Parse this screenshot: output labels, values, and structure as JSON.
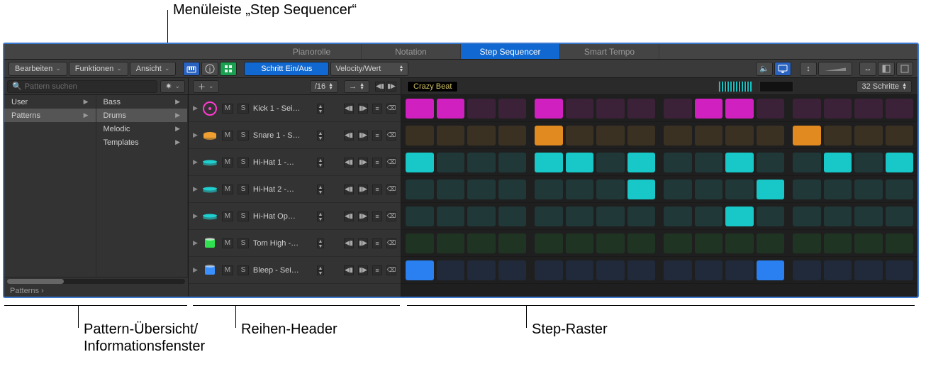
{
  "annotations": {
    "menubar": "Menüleiste „Step Sequencer“",
    "pattern_overview_1": "Pattern-Übersicht/",
    "pattern_overview_2": "Informationsfenster",
    "row_header": "Reihen-Header",
    "step_grid": "Step-Raster"
  },
  "tabs": [
    {
      "label": "Pianorolle",
      "active": false
    },
    {
      "label": "Notation",
      "active": false
    },
    {
      "label": "Step Sequencer",
      "active": true
    },
    {
      "label": "Smart Tempo",
      "active": false
    }
  ],
  "toolbar": {
    "edit": "Bearbeiten",
    "functions": "Funktionen",
    "view": "Ansicht",
    "step_toggle": "Schritt Ein/Aus",
    "mode": "Velocity/Wert"
  },
  "search": {
    "placeholder": "Pattern suchen"
  },
  "pattern": {
    "name": "Crazy Beat",
    "steps_label": "32 Schritte",
    "division": "/16"
  },
  "sidebar": {
    "col1": [
      {
        "label": "User",
        "sel": false
      },
      {
        "label": "Patterns",
        "sel": true
      }
    ],
    "col2": [
      {
        "label": "Bass",
        "sel": false
      },
      {
        "label": "Drums",
        "sel": true
      },
      {
        "label": "Melodic",
        "sel": false
      },
      {
        "label": "Templates",
        "sel": false
      }
    ],
    "breadcrumb": "Patterns  ›"
  },
  "rows": [
    {
      "name": "Kick 1 - Sei…",
      "icon": "kick",
      "color": "#ff3ad0",
      "on": "kick-on",
      "off": "kick-off",
      "steps": [
        1,
        1,
        0,
        0,
        1,
        0,
        0,
        0,
        0,
        1,
        1,
        0,
        0,
        0,
        0,
        0
      ]
    },
    {
      "name": "Snare 1 - S…",
      "icon": "snare",
      "color": "#f0a030",
      "on": "snare-on",
      "off": "snare-off",
      "steps": [
        0,
        0,
        0,
        0,
        1,
        0,
        0,
        0,
        0,
        0,
        0,
        0,
        1,
        0,
        0,
        0
      ]
    },
    {
      "name": "Hi-Hat 1 -…",
      "icon": "hihat",
      "color": "#20d0d0",
      "on": "hh-on",
      "off": "hh-off",
      "steps": [
        1,
        0,
        0,
        0,
        1,
        1,
        0,
        1,
        0,
        0,
        1,
        0,
        0,
        1,
        0,
        1
      ]
    },
    {
      "name": "Hi-Hat 2 -…",
      "icon": "hihat",
      "color": "#20d0d0",
      "on": "hh-on",
      "off": "hh-off",
      "steps": [
        0,
        0,
        0,
        0,
        0,
        0,
        0,
        1,
        0,
        0,
        0,
        1,
        0,
        0,
        0,
        0
      ]
    },
    {
      "name": "Hi-Hat Op…",
      "icon": "hihat",
      "color": "#20d0d0",
      "on": "hh-on",
      "off": "hh-off",
      "steps": [
        0,
        0,
        0,
        0,
        0,
        0,
        0,
        0,
        0,
        0,
        1,
        0,
        0,
        0,
        0,
        0
      ]
    },
    {
      "name": "Tom High -…",
      "icon": "tom",
      "color": "#30e050",
      "on": "tom-on",
      "off": "tom-off",
      "steps": [
        0,
        0,
        0,
        0,
        0,
        0,
        0,
        0,
        0,
        0,
        0,
        0,
        0,
        0,
        0,
        0
      ]
    },
    {
      "name": "Bleep - Sei…",
      "icon": "bleep",
      "color": "#3a90ff",
      "on": "bleep-on",
      "off": "bleep-off",
      "steps": [
        1,
        0,
        0,
        0,
        0,
        0,
        0,
        0,
        0,
        0,
        0,
        1,
        0,
        0,
        0,
        0
      ]
    }
  ],
  "ms": {
    "m": "M",
    "s": "S"
  }
}
